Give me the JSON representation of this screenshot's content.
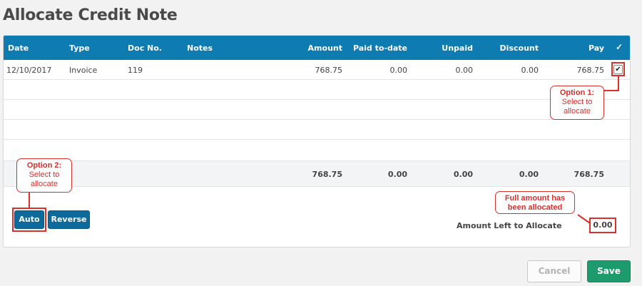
{
  "page": {
    "title": "Allocate Credit Note"
  },
  "table": {
    "headers": {
      "date": "Date",
      "type": "Type",
      "doc_no": "Doc No.",
      "notes": "Notes",
      "amount": "Amount",
      "paid_to_date": "Paid to-date",
      "unpaid": "Unpaid",
      "discount": "Discount",
      "pay": "Pay",
      "select_all": "✓"
    },
    "rows": [
      {
        "date": "12/10/2017",
        "type": "Invoice",
        "doc_no": "119",
        "notes": "",
        "amount": "768.75",
        "paid_to_date": "0.00",
        "unpaid": "0.00",
        "discount": "0.00",
        "pay": "768.75",
        "checked": true
      }
    ],
    "totals": {
      "amount": "768.75",
      "paid_to_date": "0.00",
      "unpaid": "0.00",
      "discount": "0.00",
      "pay": "768.75"
    }
  },
  "buttons": {
    "auto": "Auto",
    "reverse": "Reverse",
    "cancel": "Cancel",
    "save": "Save"
  },
  "amount_left": {
    "label": "Amount Left to Allocate",
    "value": "0.00"
  },
  "annotations": {
    "option1": {
      "title": "Option 1:",
      "line1": "Select to",
      "line2": "allocate"
    },
    "option2": {
      "title": "Option 2:",
      "line1": "Select to",
      "line2": "allocate"
    },
    "full": {
      "line1": "Full amount has",
      "line2": "been allocated"
    }
  },
  "colors": {
    "header": "#0e7bb1",
    "button": "#0e6a9a",
    "save": "#1e9b6d",
    "annotation": "#d9302b"
  }
}
